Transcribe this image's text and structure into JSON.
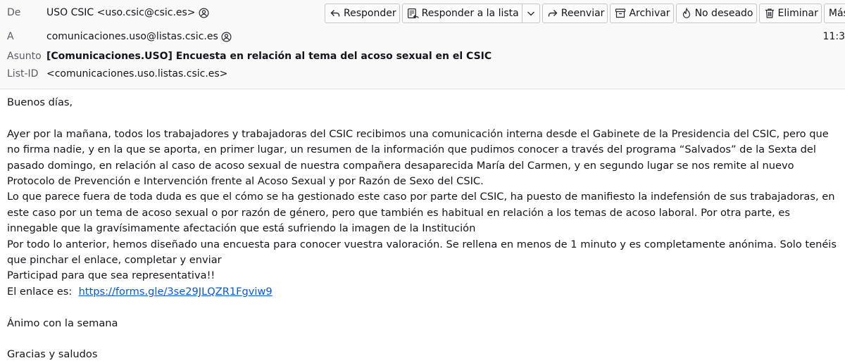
{
  "header": {
    "from_label": "De",
    "from_value": "USO CSIC <uso.csic@csic.es>",
    "to_label": "A",
    "to_value": "comunicaciones.uso@listas.csic.es",
    "subject_label": "Asunto",
    "subject_value": "[Comunicaciones.USO] Encuesta en relación al tema del acoso sexual en el CSIC",
    "listid_label": "List-ID",
    "listid_value": "<comunicaciones.uso.listas.csic.es>",
    "time": "11:3"
  },
  "toolbar": {
    "reply": "Responder",
    "reply_list": "Responder a la lista",
    "forward": "Reenviar",
    "archive": "Archivar",
    "junk": "No deseado",
    "delete": "Eliminar",
    "more": "Más"
  },
  "body": {
    "greeting": "Buenos días,",
    "paragraph1": "Ayer por la mañana, todos los trabajadores y trabajadoras del CSIC recibimos una comunicación interna desde el Gabinete de la Presidencia del CSIC, pero que no firma nadie, y en la que se aporta, en primer lugar, un resumen de la información que pudimos conocer a través  del programa “Salvados” de la Sexta del pasado domingo, en relación al caso de acoso sexual de nuestra compañera desaparecida María del Carmen, y en segundo lugar se nos remite al nuevo Protocolo de Prevención e Intervención frente al Acoso Sexual y por Razón de Sexo del CSIC.",
    "paragraph2": "Lo que parece fuera de toda duda es que el cómo se ha gestionado este caso por parte del CSIC, ha puesto de manifiesto la indefensión de sus trabajadoras, en este caso por un tema de acoso sexual o por razón de género, pero que también es habitual en relación a los temas de acoso laboral. Por otra parte, es innegable que la gravísimamente afectación que está sufriendo  la imagen de la Institución",
    "paragraph3": "Por todo lo anterior, hemos diseñado una encuesta para conocer vuestra valoración. Se rellena en menos de 1 minuto y es completamente anónima. Solo tenéis que pinchar el enlace, completar y enviar",
    "paragraph4": "Participad para que sea representativa!!",
    "link_label": "El enlace es:",
    "link_url": "https://forms.gle/3se29JLQZR1Fgviw9",
    "closing1": "Ánimo con la semana",
    "closing2": "Gracias y saludos"
  }
}
